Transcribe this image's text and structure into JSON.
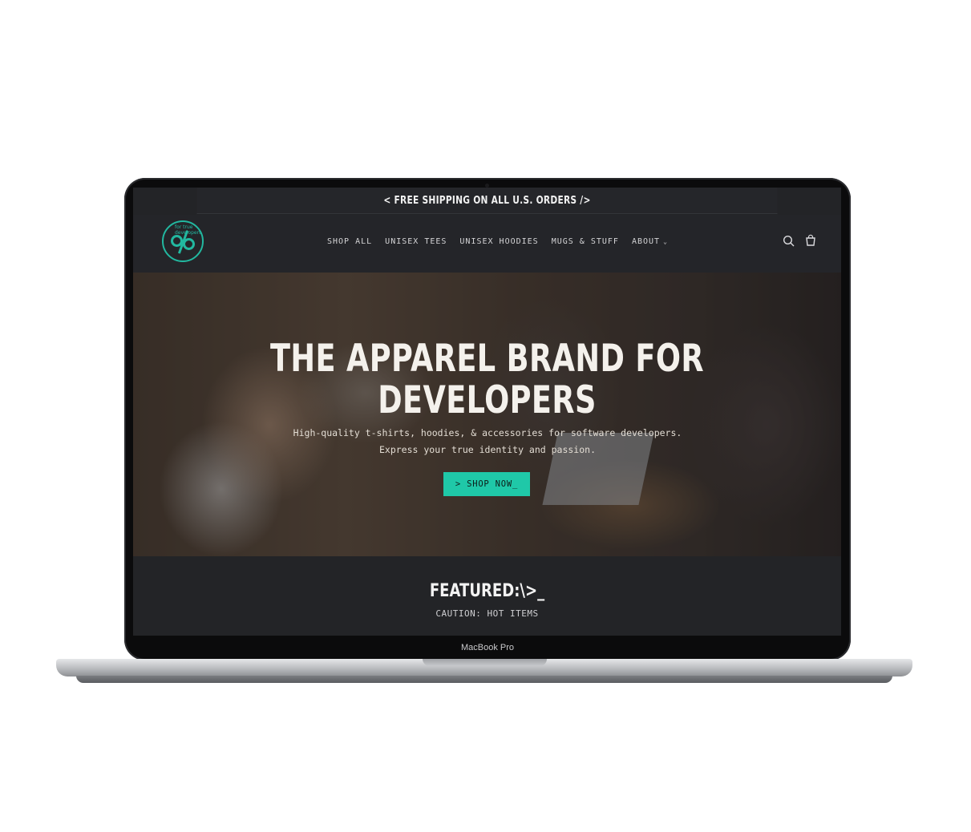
{
  "device": {
    "label": "MacBook Pro"
  },
  "announcement": {
    "text": "< FREE SHIPPING ON ALL U.S. ORDERS />"
  },
  "header": {
    "logo_text": "for true developers",
    "nav": [
      {
        "label": "SHOP ALL"
      },
      {
        "label": "UNISEX TEES"
      },
      {
        "label": "UNISEX HOODIES"
      },
      {
        "label": "MUGS & STUFF"
      },
      {
        "label": "ABOUT",
        "has_dropdown": true
      }
    ],
    "icons": [
      "search-icon",
      "cart-icon"
    ]
  },
  "hero": {
    "title_line1": "THE APPAREL BRAND FOR",
    "title_line2": "DEVELOPERS",
    "subtitle": "High-quality t-shirts, hoodies, & accessories for software developers. Express your true identity and passion.",
    "cta_label": "> SHOP NOW_"
  },
  "featured": {
    "title": "FEATURED:\\>_",
    "subtitle": "CAUTION: HOT ITEMS"
  },
  "colors": {
    "accent": "#1fc8a8",
    "background": "#232427",
    "header": "#242529"
  }
}
